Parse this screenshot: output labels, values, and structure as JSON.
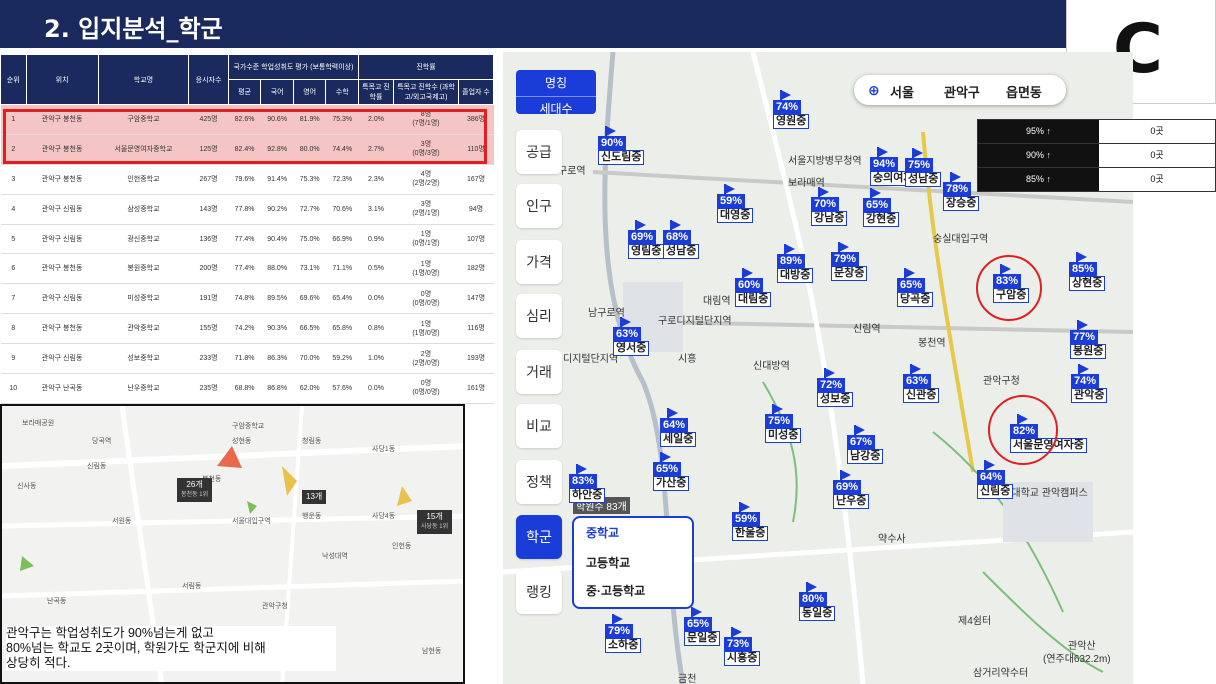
{
  "page_title": "2. 입지분석_학군",
  "badge": "C",
  "table": {
    "headers": [
      "순위",
      "위치",
      "학교명",
      "응시자수",
      "국가수준 학업성취도 평가 (보통학력이상)",
      "평균",
      "국어",
      "영어",
      "수학",
      "특목고 진학률",
      "진학률",
      "특목고 진학수 (과학고/외고국제고)",
      "졸업자 수"
    ],
    "rows": [
      [
        "1",
        "관악구 봉천동",
        "구암중학교",
        "425명",
        "82.6%",
        "90.6%",
        "81.9%",
        "75.3%",
        "2.0%",
        "8명",
        "(7명/1명)",
        "386명"
      ],
      [
        "2",
        "관악구 봉천동",
        "서울문영여자중학교",
        "125명",
        "82.4%",
        "92.8%",
        "80.0%",
        "74.4%",
        "2.7%",
        "3명",
        "(0명/3명)",
        "110명"
      ],
      [
        "3",
        "관악구 봉천동",
        "인헌중학교",
        "267명",
        "79.6%",
        "91.4%",
        "75.3%",
        "72.3%",
        "2.3%",
        "4명",
        "(2명/2명)",
        "167명"
      ],
      [
        "4",
        "관악구 신림동",
        "삼성중학교",
        "143명",
        "77.8%",
        "90.2%",
        "72.7%",
        "70.6%",
        "3.1%",
        "3명",
        "(2명/1명)",
        "94명"
      ],
      [
        "5",
        "관악구 신림동",
        "광신중학교",
        "136명",
        "77.4%",
        "90.4%",
        "75.0%",
        "66.9%",
        "0.9%",
        "1명",
        "(0명/1명)",
        "107명"
      ],
      [
        "6",
        "관악구 봉천동",
        "봉원중학교",
        "200명",
        "77.4%",
        "88.0%",
        "73.1%",
        "71.1%",
        "0.5%",
        "1명",
        "(1명/0명)",
        "182명"
      ],
      [
        "7",
        "관악구 신림동",
        "미성중학교",
        "191명",
        "74.8%",
        "89.5%",
        "69.6%",
        "65.4%",
        "0.0%",
        "0명",
        "(0명/0명)",
        "147명"
      ],
      [
        "8",
        "관악구 봉천동",
        "관악중학교",
        "155명",
        "74.2%",
        "90.3%",
        "66.5%",
        "65.8%",
        "0.8%",
        "1명",
        "(1명/0명)",
        "116명"
      ],
      [
        "9",
        "관악구 신림동",
        "성보중학교",
        "233명",
        "71.8%",
        "86.3%",
        "70.0%",
        "59.2%",
        "1.0%",
        "2명",
        "(2명/0명)",
        "193명"
      ],
      [
        "10",
        "관악구 난곡동",
        "난우중학교",
        "235명",
        "68.8%",
        "86.8%",
        "62.0%",
        "57.6%",
        "0.0%",
        "0명",
        "(0명/0명)",
        "161명"
      ]
    ]
  },
  "minimap": {
    "labels": [
      "보라매공원",
      "당곡역",
      "신림동",
      "봉천동",
      "서원동",
      "구암중학교",
      "성현동",
      "청림동",
      "사당1동",
      "서울대입구역",
      "행운동",
      "낙성대역",
      "인헌동",
      "남현동",
      "서림동",
      "난곡동",
      "신사동",
      "관악구청",
      "사당4동"
    ],
    "boxes": [
      {
        "count": "26개",
        "sub": "봉천동 1위"
      },
      {
        "count": "13개",
        "sub": ""
      },
      {
        "count": "15개",
        "sub": "사당동 1위"
      }
    ]
  },
  "summary": [
    "관악구는 학업성취도가 90%넘는게 없고",
    "80%넘는 학교도 2곳이며, 학원가도 학군지에 비해",
    "상당히 적다."
  ],
  "region": {
    "city": "서울",
    "district": "관악구",
    "dong": "읍면동"
  },
  "rates": [
    {
      "label": "95% ↑",
      "value": "0곳"
    },
    {
      "label": "90% ↑",
      "value": "0곳"
    },
    {
      "label": "85% ↑",
      "value": "0곳"
    }
  ],
  "nav_top": {
    "line1": "명칭",
    "line2": "세대수"
  },
  "side_menu": [
    "공급",
    "인구",
    "가격",
    "심리",
    "거래",
    "비교",
    "정책",
    "학군",
    "랭킹"
  ],
  "dropdown": [
    "중학교",
    "고등학교",
    "중·고등학교"
  ],
  "markers": [
    {
      "pct": "74%",
      "name": "영원중"
    },
    {
      "pct": "90%",
      "name": "신도림중"
    },
    {
      "pct": "94%",
      "name": "숭의여자중"
    },
    {
      "pct": "75%",
      "name": "성남중"
    },
    {
      "pct": "78%",
      "name": "장승중"
    },
    {
      "pct": "59%",
      "name": "대영중"
    },
    {
      "pct": "70%",
      "name": "강남중"
    },
    {
      "pct": "65%",
      "name": "강현중"
    },
    {
      "pct": "69%",
      "name": "영림중"
    },
    {
      "pct": "68%",
      "name": "성남중"
    },
    {
      "pct": "89%",
      "name": "대방중"
    },
    {
      "pct": "79%",
      "name": "문창중"
    },
    {
      "pct": "60%",
      "name": "대림중"
    },
    {
      "pct": "65%",
      "name": "당곡중"
    },
    {
      "pct": "83%",
      "name": "구암중"
    },
    {
      "pct": "85%",
      "name": "상현중"
    },
    {
      "pct": "63%",
      "name": "영서중"
    },
    {
      "pct": "77%",
      "name": "봉원중"
    },
    {
      "pct": "72%",
      "name": "성보중"
    },
    {
      "pct": "63%",
      "name": "신관중"
    },
    {
      "pct": "74%",
      "name": "관악중"
    },
    {
      "pct": "64%",
      "name": "세일중"
    },
    {
      "pct": "75%",
      "name": "미성중"
    },
    {
      "pct": "67%",
      "name": "남강중"
    },
    {
      "pct": "82%",
      "name": "서울문영여자중"
    },
    {
      "pct": "65%",
      "name": "가산중"
    },
    {
      "pct": "83%",
      "name": "하안중"
    },
    {
      "pct": "69%",
      "name": "난우중"
    },
    {
      "pct": "59%",
      "name": "한울중"
    },
    {
      "pct": "64%",
      "name": "신림중"
    },
    {
      "pct": "80%",
      "name": "동일중"
    },
    {
      "pct": "65%",
      "name": "문일중"
    },
    {
      "pct": "79%",
      "name": "소하중"
    },
    {
      "pct": "73%",
      "name": "시흥중"
    }
  ],
  "places": [
    "구로역",
    "보라매역",
    "숭실대입구역",
    "구로디지털단지역",
    "신림역",
    "봉천역",
    "관악구청",
    "대림역",
    "남구로역",
    "디지털단지역",
    "시흥",
    "신대방역",
    "약수사",
    "관악산",
    "제4쉼터",
    "삼거리약수터",
    "서울대학교 관악캠퍼스",
    "금천",
    "(연주대632.2m)",
    "서울지방병무청역"
  ],
  "school_count_tag": "학원수 83개"
}
